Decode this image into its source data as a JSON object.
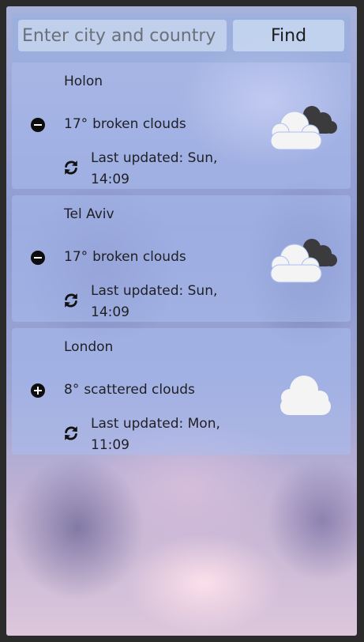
{
  "search": {
    "placeholder": "Enter city and country",
    "button_label": "Find"
  },
  "cities": [
    {
      "name": "Holon",
      "temperature": "17°",
      "description": "broken clouds",
      "updated": "Last updated: Sun, 14:09",
      "toggle_icon": "minus-circle-icon",
      "weather_icon": "broken-clouds-icon"
    },
    {
      "name": "Tel Aviv",
      "temperature": "17°",
      "description": "broken clouds",
      "updated": "Last updated: Sun, 14:09",
      "toggle_icon": "minus-circle-icon",
      "weather_icon": "broken-clouds-icon"
    },
    {
      "name": "London",
      "temperature": "8°",
      "description": "scattered clouds",
      "updated": "Last updated: Mon, 11:09",
      "toggle_icon": "plus-circle-icon",
      "weather_icon": "scattered-clouds-icon"
    }
  ],
  "icons": {
    "refresh": "refresh-icon"
  },
  "colors": {
    "panel": "#aabef0",
    "text": "#1f1f24",
    "cloud_light": "#f4f4f4",
    "cloud_dark": "#3b3b3d"
  }
}
